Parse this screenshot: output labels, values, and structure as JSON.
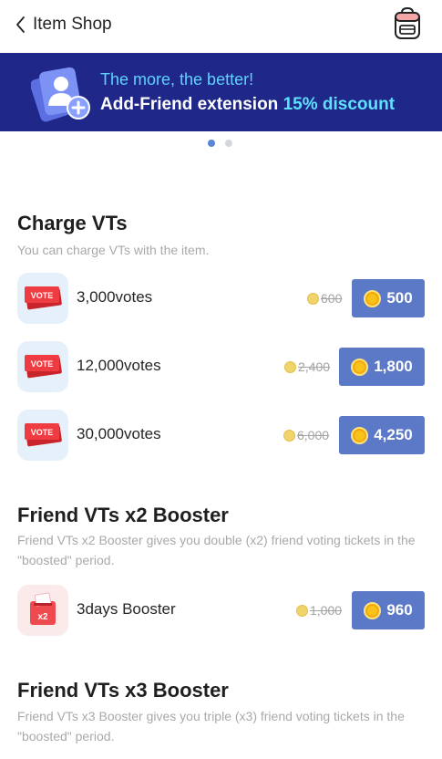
{
  "header": {
    "title": "Item Shop",
    "back_icon": "chevron-left-icon",
    "bag_icon": "backpack-icon"
  },
  "banner": {
    "line1": "The more, the better!",
    "line2_prefix": "Add-Friend extension ",
    "line2_highlight": "15% discount",
    "colors": {
      "background": "#1f2788",
      "accent": "#5fe0ff"
    }
  },
  "carousel": {
    "pages": 2,
    "active": 1
  },
  "sections": [
    {
      "title": "Charge VTs",
      "desc": "You can charge VTs with the item.",
      "items": [
        {
          "icon": "vote-ticket-icon",
          "badge": "VOTE",
          "name": "3,000votes",
          "old_price": "600",
          "price": "500"
        },
        {
          "icon": "vote-ticket-icon",
          "badge": "VOTE",
          "name": "12,000votes",
          "old_price": "2,400",
          "price": "1,800"
        },
        {
          "icon": "vote-ticket-icon",
          "badge": "VOTE",
          "name": "30,000votes",
          "old_price": "6,000",
          "price": "4,250"
        }
      ]
    },
    {
      "title": "Friend VTs x2 Booster",
      "desc": "Friend VTs x2 Booster gives you double (x2) friend voting tickets in the \"boosted\" period.",
      "items": [
        {
          "icon": "ballot-box-icon",
          "badge": "x2",
          "name": "3days Booster",
          "old_price": "1,000",
          "price": "960"
        }
      ]
    },
    {
      "title": "Friend VTs x3 Booster",
      "desc": "Friend VTs x3 Booster gives you triple (x3) friend voting tickets in the \"boosted\" period."
    }
  ],
  "colors": {
    "buy_button": "#5c79c8",
    "coin": "#f7c21a"
  }
}
